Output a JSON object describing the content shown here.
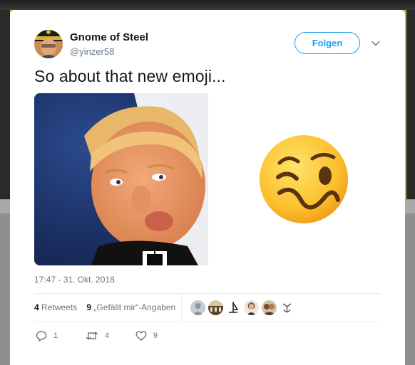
{
  "tweet": {
    "display_name": "Gnome of Steel",
    "handle": "@yinzer58",
    "follow_label": "Folgen",
    "text": "So about that new emoji...",
    "timestamp": "17:47 - 31. Okt. 2018",
    "stats": {
      "retweets_count": "4",
      "retweets_label": "Retweets",
      "likes_count": "9",
      "likes_label": "„Gefällt mir“-Angaben"
    },
    "actions": {
      "reply_count": "1",
      "retweet_count": "4",
      "like_count": "9"
    }
  },
  "colors": {
    "accent": "#1da1f2",
    "secondary_text": "#657786",
    "primary_text": "#14171a"
  },
  "icons": [
    "chevron-down-icon",
    "reply-icon",
    "retweet-icon",
    "heart-icon"
  ]
}
